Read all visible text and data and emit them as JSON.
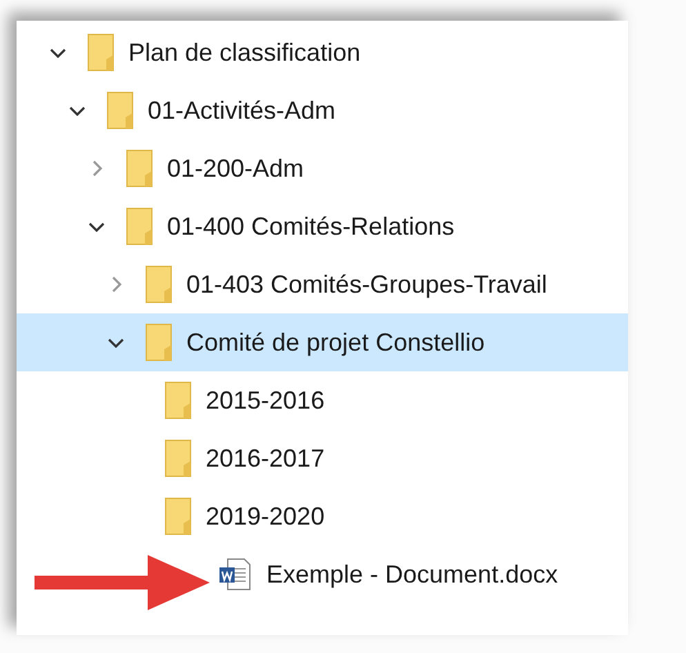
{
  "tree": [
    {
      "label": "Plan de classification",
      "kind": "folder",
      "expanded": true,
      "selected": false,
      "children": [
        {
          "label": "01-Activités-Adm",
          "kind": "folder",
          "expanded": true,
          "selected": false,
          "children": [
            {
              "label": "01-200-Adm",
              "kind": "folder",
              "expanded": false,
              "selected": false
            },
            {
              "label": "01-400 Comités-Relations",
              "kind": "folder",
              "expanded": true,
              "selected": false,
              "children": [
                {
                  "label": "01-403 Comités-Groupes-Travail",
                  "kind": "folder",
                  "expanded": false,
                  "selected": false
                },
                {
                  "label": "Comité de projet Constellio",
                  "kind": "folder",
                  "expanded": true,
                  "selected": true,
                  "children": [
                    {
                      "label": "2015-2016",
                      "kind": "folder",
                      "selected": false
                    },
                    {
                      "label": "2016-2017",
                      "kind": "folder",
                      "selected": false
                    },
                    {
                      "label": "2019-2020",
                      "kind": "folder",
                      "selected": false,
                      "children": [
                        {
                          "label": "Exemple - Document.docx",
                          "kind": "file",
                          "selected": false
                        }
                      ]
                    }
                  ]
                }
              ]
            }
          ]
        }
      ]
    }
  ],
  "callout": {
    "kind": "arrow"
  }
}
